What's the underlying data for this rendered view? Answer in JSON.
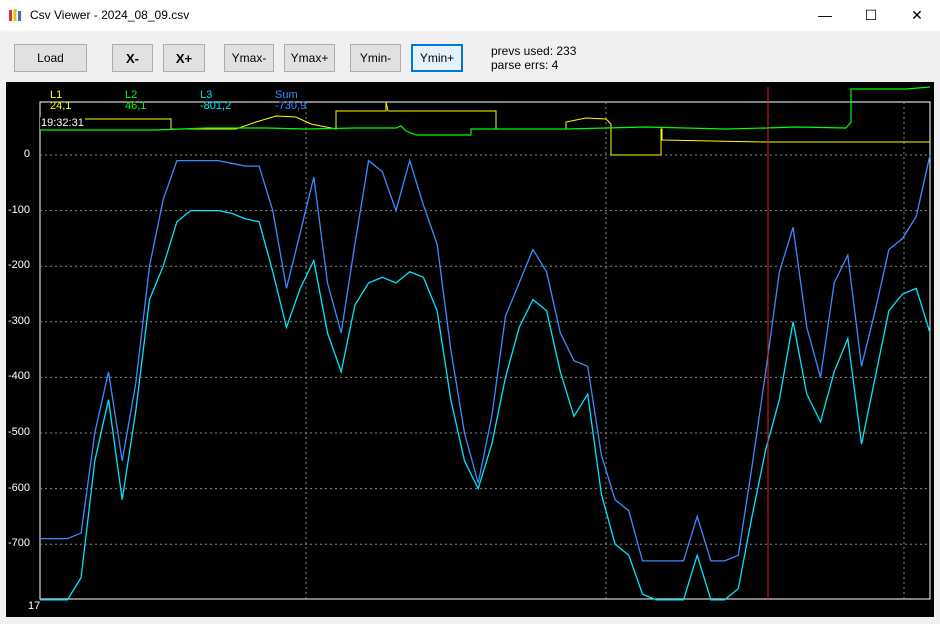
{
  "window": {
    "title": "Csv Viewer - 2024_08_09.csv",
    "minimize_glyph": "—",
    "maximize_glyph": "☐",
    "close_glyph": "✕"
  },
  "toolbar": {
    "load": "Load",
    "x_minus": "X-",
    "x_plus": "X+",
    "ymax_minus": "Ymax-",
    "ymax_plus": "Ymax+",
    "ymin_minus": "Ymin-",
    "ymin_plus": "Ymin+"
  },
  "status": {
    "prevs_used": "prevs used: 233",
    "parse_errs": "parse errs: 4"
  },
  "chart_data": {
    "type": "line",
    "yticks": [
      "0",
      "-100",
      "-200",
      "-300",
      "-400",
      "-500",
      "-600",
      "-700"
    ],
    "ylim": [
      -800,
      0
    ],
    "x_start_label": "17",
    "cursor_time": "19:32:31",
    "grid": true,
    "legend": [
      {
        "name": "L1",
        "value": "24,1",
        "color": "#ffff00"
      },
      {
        "name": "L2",
        "value": "46,1",
        "color": "#00ff00"
      },
      {
        "name": "L3",
        "value": "-801,2",
        "color": "#00e5ff"
      },
      {
        "name": "Sum",
        "value": "-730,9",
        "color": "#3b8bff"
      }
    ],
    "series": [
      {
        "name": "L3",
        "values": [
          -800,
          -800,
          -800,
          -760,
          -550,
          -440,
          -620,
          -460,
          -260,
          -200,
          -120,
          -100,
          -100,
          -100,
          -105,
          -115,
          -120,
          -210,
          -310,
          -240,
          -190,
          -320,
          -390,
          -270,
          -230,
          -220,
          -230,
          -210,
          -220,
          -280,
          -440,
          -550,
          -600,
          -520,
          -400,
          -310,
          -260,
          -280,
          -390,
          -470,
          -430,
          -610,
          -700,
          -720,
          -790,
          -800,
          -800,
          -800,
          -720,
          -800,
          -800,
          -780,
          -650,
          -530,
          -440,
          -300,
          -430,
          -480,
          -390,
          -330,
          -520,
          -400,
          -280,
          -250,
          -240,
          -320
        ]
      },
      {
        "name": "Sum",
        "values": [
          -690,
          -690,
          -690,
          -680,
          -500,
          -390,
          -550,
          -410,
          -200,
          -80,
          -10,
          -10,
          -10,
          -10,
          -15,
          -20,
          -20,
          -100,
          -240,
          -140,
          -40,
          -230,
          -320,
          -160,
          -10,
          -30,
          -100,
          -10,
          -90,
          -160,
          -350,
          -500,
          -590,
          -470,
          -290,
          -230,
          -170,
          -210,
          -320,
          -370,
          -380,
          -540,
          -620,
          -640,
          -730,
          -730,
          -730,
          -730,
          -650,
          -730,
          -730,
          -720,
          -560,
          -390,
          -210,
          -130,
          -310,
          -400,
          -230,
          -180,
          -380,
          -280,
          -170,
          -150,
          -110,
          0
        ]
      }
    ]
  }
}
